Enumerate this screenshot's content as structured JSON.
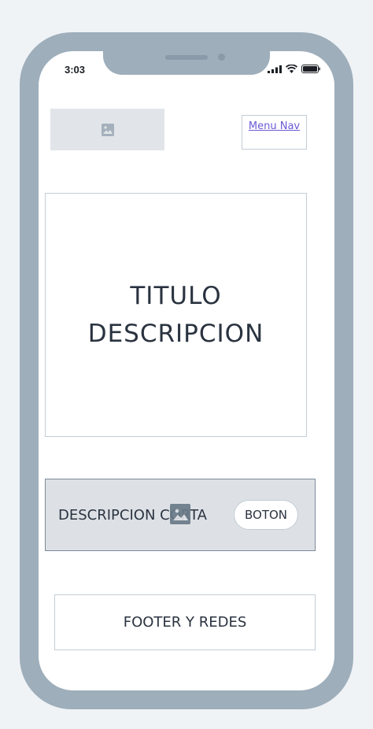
{
  "status_bar": {
    "time": "3:03",
    "icons": [
      "cellular-signal-icon",
      "wifi-icon",
      "battery-icon"
    ]
  },
  "header": {
    "logo_icon": "image-placeholder-icon",
    "menu_nav_label": "Menu Nav"
  },
  "hero": {
    "title": "TITULO",
    "description": "DESCRIPCION"
  },
  "cta": {
    "text": "DESCRIPCION CORTA",
    "image_icon": "image-placeholder-icon",
    "button_label": "BOTON"
  },
  "footer": {
    "label": "FOOTER Y REDES"
  },
  "colors": {
    "page_bg": "#f0f3f6",
    "phone_frame": "#9eaebb",
    "link": "#6a5ad6",
    "text": "#2a3340",
    "border": "#c3cdd6",
    "cta_bg": "#dde1e5"
  }
}
